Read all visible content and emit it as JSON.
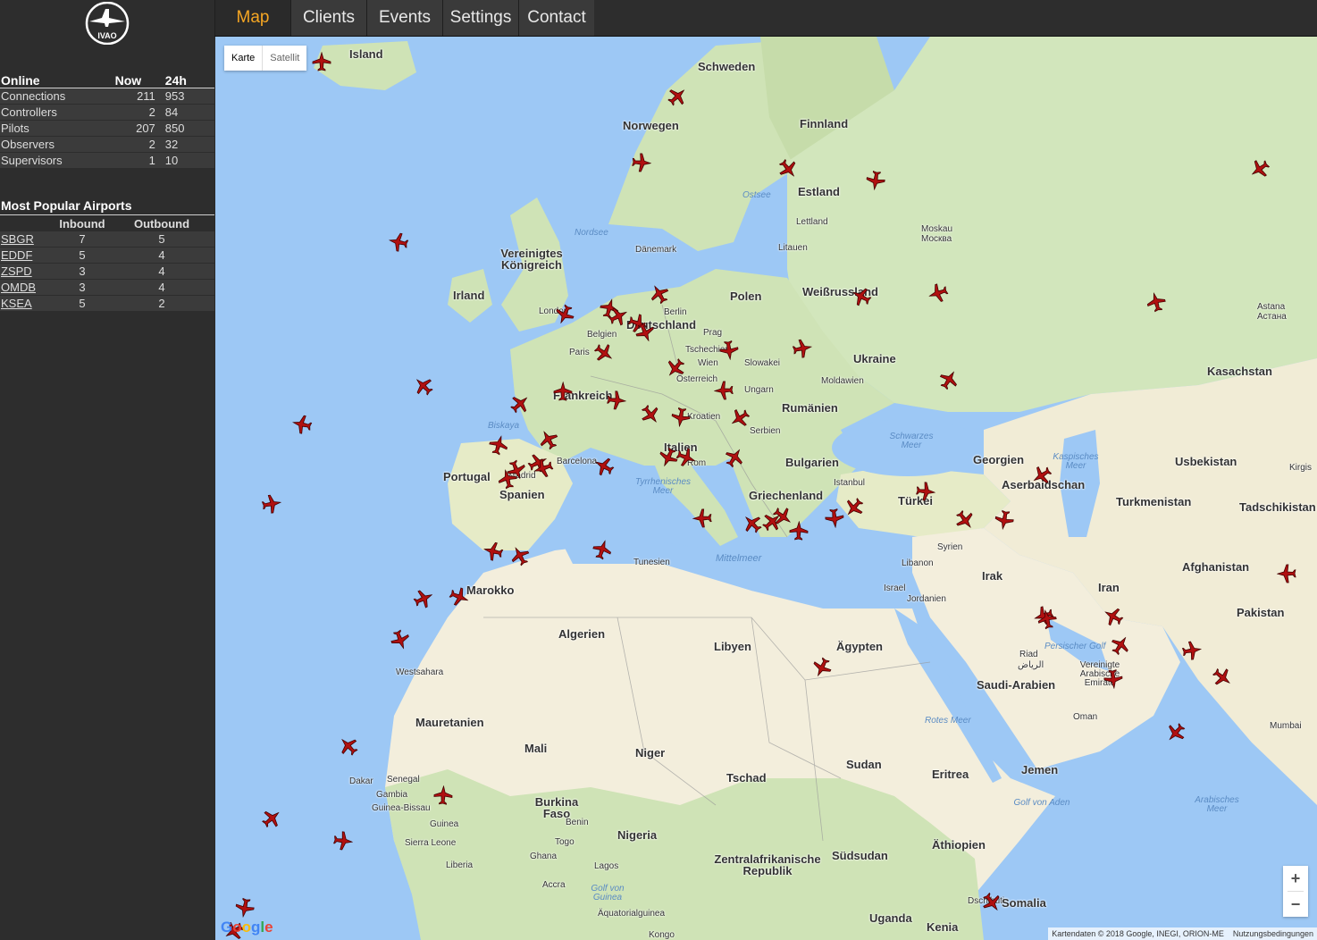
{
  "sidebar": {
    "logo_text": "IVAO",
    "online": {
      "headers": [
        "Online",
        "Now",
        "24h"
      ],
      "rows": [
        {
          "label": "Connections",
          "now": "211",
          "day": "953"
        },
        {
          "label": "Controllers",
          "now": "2",
          "day": "84"
        },
        {
          "label": "Pilots",
          "now": "207",
          "day": "850"
        },
        {
          "label": "Observers",
          "now": "2",
          "day": "32"
        },
        {
          "label": "Supervisors",
          "now": "1",
          "day": "10"
        }
      ]
    },
    "airports": {
      "title": "Most Popular Airports",
      "headers": [
        "",
        "Inbound",
        "Outbound"
      ],
      "rows": [
        {
          "code": "SBGR",
          "inbound": "7",
          "outbound": "5"
        },
        {
          "code": "EDDF",
          "inbound": "5",
          "outbound": "4"
        },
        {
          "code": "ZSPD",
          "inbound": "3",
          "outbound": "4"
        },
        {
          "code": "OMDB",
          "inbound": "3",
          "outbound": "4"
        },
        {
          "code": "KSEA",
          "inbound": "5",
          "outbound": "2"
        }
      ]
    }
  },
  "nav": {
    "items": [
      "Map",
      "Clients",
      "Events",
      "Settings",
      "Contact"
    ],
    "active": "Map"
  },
  "map": {
    "type_buttons": {
      "map": "Karte",
      "satellite": "Satellit"
    },
    "zoom_in": "+",
    "zoom_out": "−",
    "attribution": "Kartendaten © 2018 Google, INEGI, ORION-ME",
    "terms": "Nutzungsbedingungen",
    "google_logo": "Google",
    "colors": {
      "water": "#9dc8f5",
      "land_green": "#cfe3b6",
      "land_desert": "#f3eedc",
      "plane": "#b01010"
    },
    "countries": [
      "Island",
      "Schweden",
      "Norwegen",
      "Finnland",
      "Estland",
      "Lettland",
      "Litauen",
      "Vereinigtes Königreich",
      "Irland",
      "Dänemark",
      "Polen",
      "Weißrussland",
      "Deutschland",
      "Belgien",
      "Tschechien",
      "Slowakei",
      "Österreich",
      "Ukraine",
      "Moldawien",
      "Frankreich",
      "Ungarn",
      "Kroatien",
      "Rumänien",
      "Serbien",
      "Italien",
      "Bulgarien",
      "Griechenland",
      "Portugal",
      "Spanien",
      "Türkei",
      "Georgien",
      "Aserbaidschan",
      "Kasachstan",
      "Usbekistan",
      "Turkmenistan",
      "Tadschikistan",
      "Kirgis",
      "Afghanistan",
      "Iran",
      "Pakistan",
      "Irak",
      "Syrien",
      "Libanon",
      "Israel",
      "Jordanien",
      "Saudi-Arabien",
      "Vereinigte Arabische Emirate",
      "Oman",
      "Jemen",
      "Tunesien",
      "Marokko",
      "Algerien",
      "Libyen",
      "Ägypten",
      "Westsahara",
      "Mauretanien",
      "Mali",
      "Niger",
      "Tschad",
      "Sudan",
      "Eritrea",
      "Senegal",
      "Gambia",
      "Guinea-Bissau",
      "Guinea",
      "Sierra Leone",
      "Liberia",
      "Burkina Faso",
      "Benin",
      "Togo",
      "Ghana",
      "Nigeria",
      "Zentralafrikanische Republik",
      "Südsudan",
      "Äthiopien",
      "Dschibuti",
      "Somalia",
      "Kenia",
      "Uganda",
      "Äquatorialguinea",
      "Kongo"
    ],
    "cities": [
      "London",
      "Paris",
      "Berlin",
      "Prag",
      "Wien",
      "Madrid",
      "Barcelona",
      "Rom",
      "Istanbul",
      "Moskau",
      "Москва",
      "Astana",
      "Астана",
      "Riad",
      "الرياض",
      "Dakar",
      "Lagos",
      "Accra",
      "Mumbai"
    ],
    "seas": [
      "Nordsee",
      "Ostsee",
      "Biskaya",
      "Tyrrhenisches Meer",
      "Mittelmeer",
      "Schwarzes Meer",
      "Kaspisches Meer",
      "Persischer Golf",
      "Rotes Meer",
      "Golf von Aden",
      "Arabisches Meer",
      "Golf von Guinea"
    ]
  }
}
